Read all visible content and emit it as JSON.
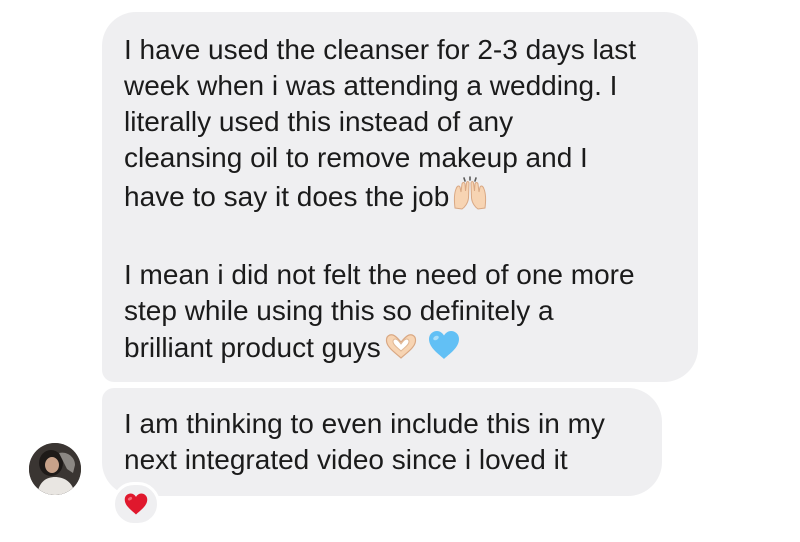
{
  "messages": [
    {
      "paragraphs": [
        "I have used the cleanser for 2-3 days last\nweek when i was attending a wedding. I\nliterally used this instead of any\ncleansing oil to remove makeup and I\nhave to say it does the job",
        "I mean i did not felt the need of one more\nstep while using this so definitely a\nbrilliant product guys"
      ],
      "emojis": [
        "raising-hands-icon",
        "heart-hands-icon",
        "light-blue-heart-icon"
      ]
    },
    {
      "paragraphs": [
        "I am thinking to even include this in my\nnext integrated video since i loved it"
      ],
      "reaction": "red-heart-icon"
    }
  ],
  "colors": {
    "bubble": "#efeff1",
    "text": "#1b1b1b",
    "heart_blue": "#62c0f5",
    "heart_red": "#e0182d",
    "skin": "#f7d4b3"
  }
}
